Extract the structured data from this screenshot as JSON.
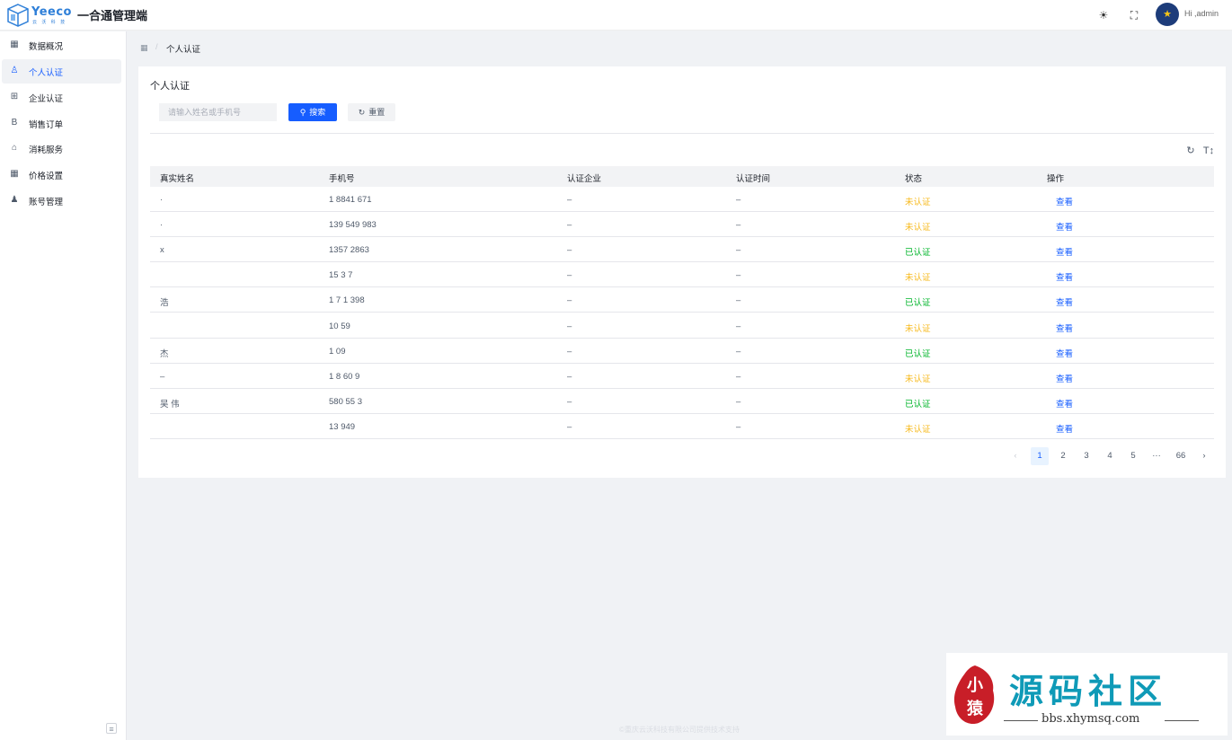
{
  "header": {
    "brand": "Yeeco",
    "brand_sub": "云 沃 科 技",
    "app_title": "一合通管理端",
    "greeting": "Hi ,admin",
    "icons": [
      "sun-icon",
      "fullscreen-icon"
    ]
  },
  "sidebar": {
    "items": [
      {
        "label": "数据概况",
        "icon": "grid-icon"
      },
      {
        "label": "个人认证",
        "icon": "user-icon",
        "active": true
      },
      {
        "label": "企业认证",
        "icon": "layout-icon"
      },
      {
        "label": "销售订单",
        "icon": "bold-b-icon"
      },
      {
        "label": "消耗服务",
        "icon": "layers-icon"
      },
      {
        "label": "价格设置",
        "icon": "apps-icon"
      },
      {
        "label": "账号管理",
        "icon": "user-group-icon"
      }
    ]
  },
  "breadcrumb": {
    "current": "个人认证"
  },
  "page": {
    "title": "个人认证",
    "search_placeholder": "请输入姓名或手机号",
    "search_value": "",
    "search_button": "搜索",
    "reset_button": "重置"
  },
  "table": {
    "columns": [
      "真实姓名",
      "手机号",
      "认证企业",
      "认证时间",
      "状态",
      "操作"
    ],
    "rows": [
      {
        "name": "·",
        "phone": "1 8841 671",
        "company": "–",
        "time": "–",
        "status": "未认证",
        "action": "查看"
      },
      {
        "name": "·",
        "phone": "139 549 983",
        "company": "–",
        "time": "–",
        "status": "未认证",
        "action": "查看"
      },
      {
        "name": "x",
        "phone": "1357 2863",
        "company": "–",
        "time": "–",
        "status": "已认证",
        "action": "查看"
      },
      {
        "name": "",
        "phone": "15 3 7",
        "company": "–",
        "time": "–",
        "status": "未认证",
        "action": "查看"
      },
      {
        "name": "浩",
        "phone": "1 7 1 398",
        "company": "–",
        "time": "–",
        "status": "已认证",
        "action": "查看"
      },
      {
        "name": "",
        "phone": "10 59",
        "company": "–",
        "time": "–",
        "status": "未认证",
        "action": "查看"
      },
      {
        "name": "杰",
        "phone": "1 09",
        "company": "–",
        "time": "–",
        "status": "已认证",
        "action": "查看"
      },
      {
        "name": "–",
        "phone": "1 8 60 9",
        "company": "–",
        "time": "–",
        "status": "未认证",
        "action": "查看"
      },
      {
        "name": "吴 伟",
        "phone": "580 55 3",
        "company": "–",
        "time": "–",
        "status": "已认证",
        "action": "查看"
      },
      {
        "name": "",
        "phone": "13 949",
        "company": "–",
        "time": "–",
        "status": "未认证",
        "action": "查看"
      }
    ]
  },
  "pagination": {
    "prev": "‹",
    "pages": [
      "1",
      "2",
      "3",
      "4",
      "5"
    ],
    "ellipsis": "···",
    "last": "66",
    "next": "›",
    "current": "1"
  },
  "footer": {
    "text": "©重庆云沃科技有限公司提供技术支持"
  },
  "watermark": {
    "seal": "小猿",
    "main": "源码社区",
    "url": "bbs.xhymsq.com"
  },
  "colors": {
    "primary": "#165dff",
    "success": "#00b42a",
    "warning": "#f7ba1e",
    "watermark": "#0f9ab7",
    "seal": "#c81e28"
  }
}
